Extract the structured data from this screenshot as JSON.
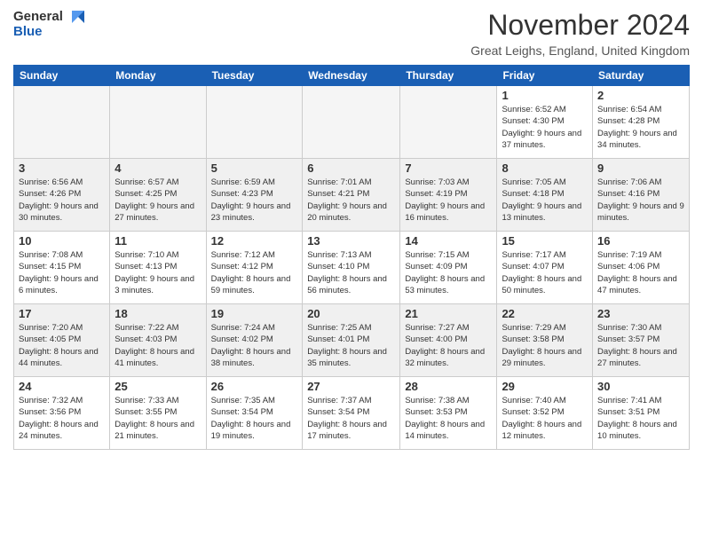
{
  "header": {
    "logo": {
      "general": "General",
      "blue": "Blue"
    },
    "title": "November 2024",
    "location": "Great Leighs, England, United Kingdom"
  },
  "calendar": {
    "days_of_week": [
      "Sunday",
      "Monday",
      "Tuesday",
      "Wednesday",
      "Thursday",
      "Friday",
      "Saturday"
    ],
    "weeks": [
      [
        {
          "day": "",
          "empty": true
        },
        {
          "day": "",
          "empty": true
        },
        {
          "day": "",
          "empty": true
        },
        {
          "day": "",
          "empty": true
        },
        {
          "day": "",
          "empty": true
        },
        {
          "day": "1",
          "info": "Sunrise: 6:52 AM\nSunset: 4:30 PM\nDaylight: 9 hours\nand 37 minutes."
        },
        {
          "day": "2",
          "info": "Sunrise: 6:54 AM\nSunset: 4:28 PM\nDaylight: 9 hours\nand 34 minutes."
        }
      ],
      [
        {
          "day": "3",
          "info": "Sunrise: 6:56 AM\nSunset: 4:26 PM\nDaylight: 9 hours\nand 30 minutes.",
          "shaded": true
        },
        {
          "day": "4",
          "info": "Sunrise: 6:57 AM\nSunset: 4:25 PM\nDaylight: 9 hours\nand 27 minutes.",
          "shaded": true
        },
        {
          "day": "5",
          "info": "Sunrise: 6:59 AM\nSunset: 4:23 PM\nDaylight: 9 hours\nand 23 minutes.",
          "shaded": true
        },
        {
          "day": "6",
          "info": "Sunrise: 7:01 AM\nSunset: 4:21 PM\nDaylight: 9 hours\nand 20 minutes.",
          "shaded": true
        },
        {
          "day": "7",
          "info": "Sunrise: 7:03 AM\nSunset: 4:19 PM\nDaylight: 9 hours\nand 16 minutes.",
          "shaded": true
        },
        {
          "day": "8",
          "info": "Sunrise: 7:05 AM\nSunset: 4:18 PM\nDaylight: 9 hours\nand 13 minutes.",
          "shaded": true
        },
        {
          "day": "9",
          "info": "Sunrise: 7:06 AM\nSunset: 4:16 PM\nDaylight: 9 hours\nand 9 minutes.",
          "shaded": true
        }
      ],
      [
        {
          "day": "10",
          "info": "Sunrise: 7:08 AM\nSunset: 4:15 PM\nDaylight: 9 hours\nand 6 minutes."
        },
        {
          "day": "11",
          "info": "Sunrise: 7:10 AM\nSunset: 4:13 PM\nDaylight: 9 hours\nand 3 minutes."
        },
        {
          "day": "12",
          "info": "Sunrise: 7:12 AM\nSunset: 4:12 PM\nDaylight: 8 hours\nand 59 minutes."
        },
        {
          "day": "13",
          "info": "Sunrise: 7:13 AM\nSunset: 4:10 PM\nDaylight: 8 hours\nand 56 minutes."
        },
        {
          "day": "14",
          "info": "Sunrise: 7:15 AM\nSunset: 4:09 PM\nDaylight: 8 hours\nand 53 minutes."
        },
        {
          "day": "15",
          "info": "Sunrise: 7:17 AM\nSunset: 4:07 PM\nDaylight: 8 hours\nand 50 minutes."
        },
        {
          "day": "16",
          "info": "Sunrise: 7:19 AM\nSunset: 4:06 PM\nDaylight: 8 hours\nand 47 minutes."
        }
      ],
      [
        {
          "day": "17",
          "info": "Sunrise: 7:20 AM\nSunset: 4:05 PM\nDaylight: 8 hours\nand 44 minutes.",
          "shaded": true
        },
        {
          "day": "18",
          "info": "Sunrise: 7:22 AM\nSunset: 4:03 PM\nDaylight: 8 hours\nand 41 minutes.",
          "shaded": true
        },
        {
          "day": "19",
          "info": "Sunrise: 7:24 AM\nSunset: 4:02 PM\nDaylight: 8 hours\nand 38 minutes.",
          "shaded": true
        },
        {
          "day": "20",
          "info": "Sunrise: 7:25 AM\nSunset: 4:01 PM\nDaylight: 8 hours\nand 35 minutes.",
          "shaded": true
        },
        {
          "day": "21",
          "info": "Sunrise: 7:27 AM\nSunset: 4:00 PM\nDaylight: 8 hours\nand 32 minutes.",
          "shaded": true
        },
        {
          "day": "22",
          "info": "Sunrise: 7:29 AM\nSunset: 3:58 PM\nDaylight: 8 hours\nand 29 minutes.",
          "shaded": true
        },
        {
          "day": "23",
          "info": "Sunrise: 7:30 AM\nSunset: 3:57 PM\nDaylight: 8 hours\nand 27 minutes.",
          "shaded": true
        }
      ],
      [
        {
          "day": "24",
          "info": "Sunrise: 7:32 AM\nSunset: 3:56 PM\nDaylight: 8 hours\nand 24 minutes."
        },
        {
          "day": "25",
          "info": "Sunrise: 7:33 AM\nSunset: 3:55 PM\nDaylight: 8 hours\nand 21 minutes."
        },
        {
          "day": "26",
          "info": "Sunrise: 7:35 AM\nSunset: 3:54 PM\nDaylight: 8 hours\nand 19 minutes."
        },
        {
          "day": "27",
          "info": "Sunrise: 7:37 AM\nSunset: 3:54 PM\nDaylight: 8 hours\nand 17 minutes."
        },
        {
          "day": "28",
          "info": "Sunrise: 7:38 AM\nSunset: 3:53 PM\nDaylight: 8 hours\nand 14 minutes."
        },
        {
          "day": "29",
          "info": "Sunrise: 7:40 AM\nSunset: 3:52 PM\nDaylight: 8 hours\nand 12 minutes."
        },
        {
          "day": "30",
          "info": "Sunrise: 7:41 AM\nSunset: 3:51 PM\nDaylight: 8 hours\nand 10 minutes."
        }
      ]
    ]
  }
}
